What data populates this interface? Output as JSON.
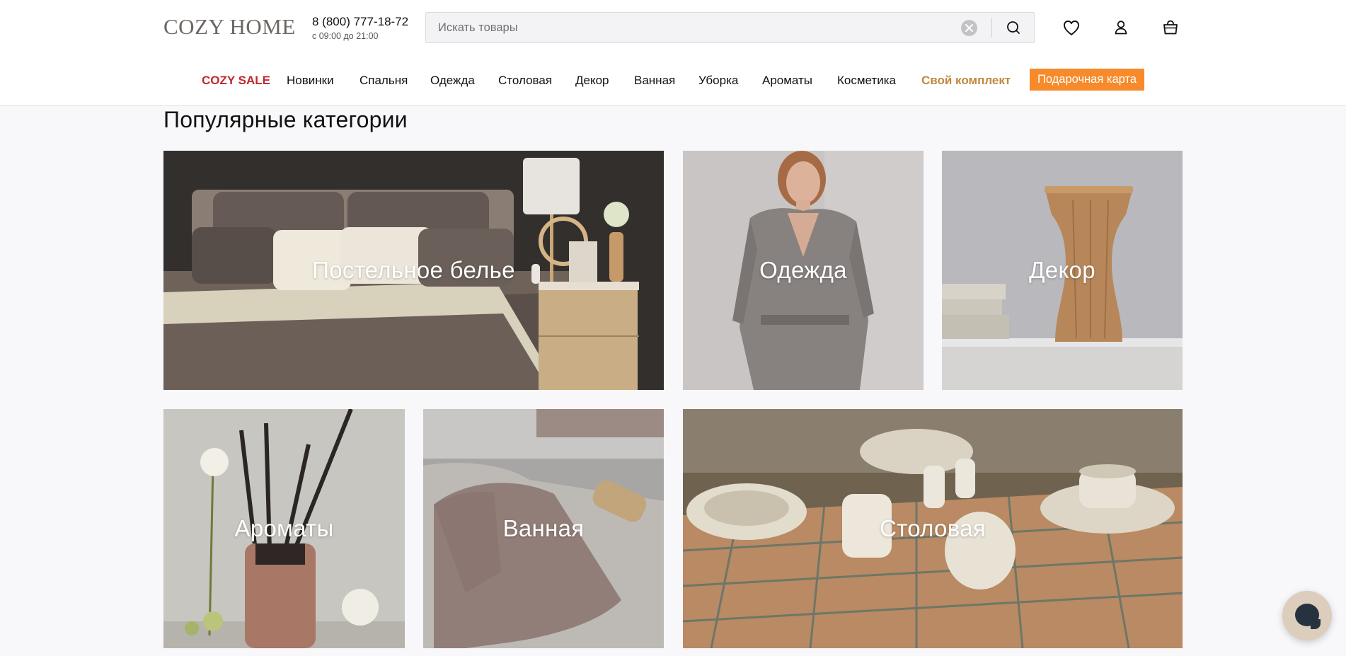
{
  "header": {
    "logo": "COZY HOME",
    "phone": "8 (800) 777-18-72",
    "hours": "с 09:00 до 21:00",
    "search_placeholder": "Искать товары",
    "icons": [
      "clear-icon",
      "search-icon",
      "heart-icon",
      "user-icon",
      "cart-icon"
    ]
  },
  "nav": {
    "items": [
      {
        "label": "COZY SALE",
        "style": "sale",
        "color": "#c0282d"
      },
      {
        "label": "Новинки"
      },
      {
        "label": "Спальня"
      },
      {
        "label": "Одежда"
      },
      {
        "label": "Столовая"
      },
      {
        "label": "Декор"
      },
      {
        "label": "Ванная"
      },
      {
        "label": "Уборка"
      },
      {
        "label": "Ароматы"
      },
      {
        "label": "Косметика"
      },
      {
        "label": "Свой комплект",
        "style": "kit",
        "color": "#c1883d"
      }
    ],
    "gift_card": {
      "label": "Подарочная карта",
      "color": "#f78a2a"
    }
  },
  "main": {
    "section_title": "Популярные категории",
    "categories": [
      {
        "label": "Постельное белье"
      },
      {
        "label": "Одежда"
      },
      {
        "label": "Декор"
      },
      {
        "label": "Ароматы"
      },
      {
        "label": "Ванная"
      },
      {
        "label": "Столовая"
      }
    ]
  },
  "chat": {
    "icon": "chat-icon"
  }
}
